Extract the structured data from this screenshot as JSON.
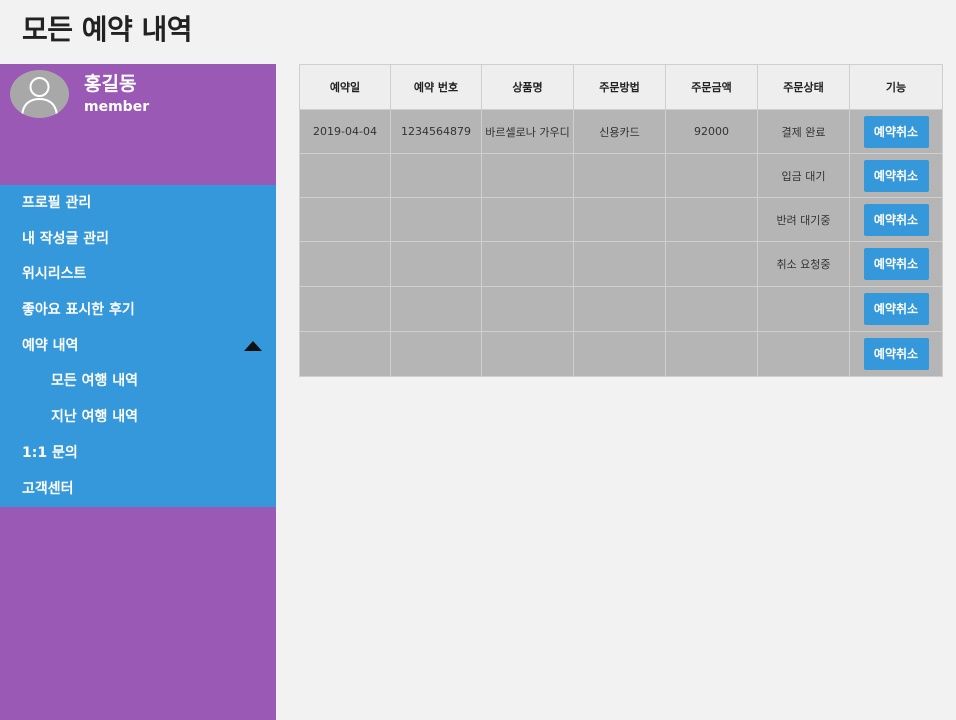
{
  "page": {
    "title": "모든 예약 내역"
  },
  "profile": {
    "name": "홍길동",
    "role": "member",
    "avatar_icon": "user-silhouette-icon"
  },
  "sidebar": {
    "items": [
      {
        "label": "프로필 관리"
      },
      {
        "label": "내 작성글 관리"
      },
      {
        "label": "위시리스트"
      },
      {
        "label": "좋아요 표시한 후기"
      },
      {
        "label": "예약 내역"
      },
      {
        "label": "모든 여행 내역"
      },
      {
        "label": "지난 여행 내역"
      },
      {
        "label": "1:1 문의"
      },
      {
        "label": "고객센터"
      }
    ]
  },
  "colors": {
    "sidebar_bg": "#9b59b6",
    "menu_bg": "#3498db",
    "button_bg": "#3498db",
    "table_cell_bg": "#b5b5b5",
    "table_header_bg": "#eeeeee"
  },
  "table": {
    "headers": [
      "예약일",
      "예약 번호",
      "상품명",
      "주문방법",
      "주문금액",
      "주문상태",
      "기능"
    ],
    "rows": [
      {
        "date": "2019-04-04",
        "number": "1234564879",
        "product": "바르셀로나 가우디",
        "method": "신용카드",
        "amount": "92000",
        "status": "결제 완료",
        "action": "예약취소"
      },
      {
        "date": "",
        "number": "",
        "product": "",
        "method": "",
        "amount": "",
        "status": "입금 대기",
        "action": "예약취소"
      },
      {
        "date": "",
        "number": "",
        "product": "",
        "method": "",
        "amount": "",
        "status": "반려 대기중",
        "action": "예약취소"
      },
      {
        "date": "",
        "number": "",
        "product": "",
        "method": "",
        "amount": "",
        "status": "취소 요청중",
        "action": "예약취소"
      },
      {
        "date": "",
        "number": "",
        "product": "",
        "method": "",
        "amount": "",
        "status": "",
        "action": "예약취소"
      },
      {
        "date": "",
        "number": "",
        "product": "",
        "method": "",
        "amount": "",
        "status": "",
        "action": "예약취소"
      }
    ]
  }
}
